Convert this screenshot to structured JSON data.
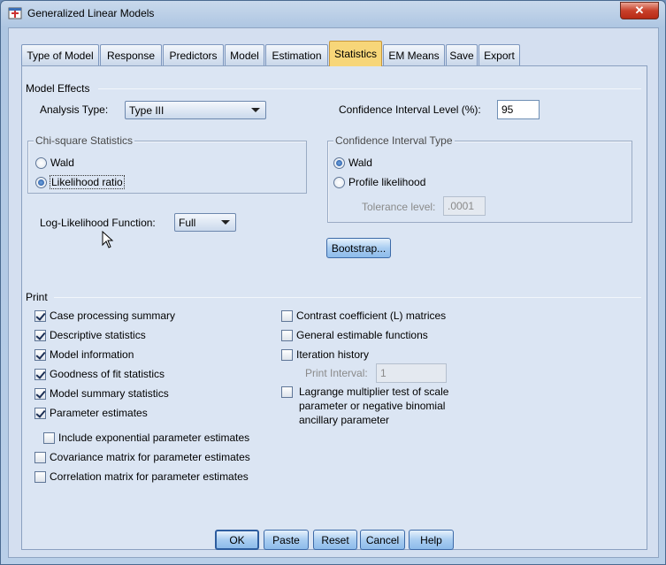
{
  "window": {
    "title": "Generalized Linear Models",
    "close_label": "✕"
  },
  "tabs": [
    {
      "label": "Type of Model",
      "active": false
    },
    {
      "label": "Response",
      "active": false
    },
    {
      "label": "Predictors",
      "active": false
    },
    {
      "label": "Model",
      "active": false
    },
    {
      "label": "Estimation",
      "active": false
    },
    {
      "label": "Statistics",
      "active": true
    },
    {
      "label": "EM Means",
      "active": false
    },
    {
      "label": "Save",
      "active": false
    },
    {
      "label": "Export",
      "active": false
    }
  ],
  "model_effects": {
    "section_label": "Model Effects",
    "analysis_type_label": "Analysis Type:",
    "analysis_type_value": "Type III",
    "ci_level_label": "Confidence Interval Level (%):",
    "ci_level_value": "95"
  },
  "chi_square": {
    "title": "Chi-square Statistics",
    "wald_label": "Wald",
    "likelihood_label": "Likelihood ratio",
    "selected": "likelihood"
  },
  "ci_type": {
    "title": "Confidence Interval Type",
    "wald_label": "Wald",
    "profile_label": "Profile likelihood",
    "selected": "wald",
    "tolerance_label": "Tolerance level:",
    "tolerance_value": ".0001"
  },
  "log_likelihood": {
    "label": "Log-Likelihood Function:",
    "value": "Full"
  },
  "bootstrap_label": "Bootstrap...",
  "print": {
    "section_label": "Print",
    "left": [
      {
        "label": "Case processing summary",
        "checked": true
      },
      {
        "label": "Descriptive statistics",
        "checked": true
      },
      {
        "label": "Model information",
        "checked": true
      },
      {
        "label": "Goodness of fit statistics",
        "checked": true
      },
      {
        "label": "Model summary statistics",
        "checked": true
      },
      {
        "label": "Parameter estimates",
        "checked": true
      }
    ],
    "include_exp": {
      "label": "Include exponential parameter estimates",
      "checked": false
    },
    "covariance": {
      "label": "Covariance matrix for parameter estimates",
      "checked": false
    },
    "correlation": {
      "label": "Correlation matrix for parameter estimates",
      "checked": false
    },
    "right": [
      {
        "label": "Contrast coefficient (L) matrices",
        "checked": false
      },
      {
        "label": "General estimable functions",
        "checked": false
      },
      {
        "label": "Iteration history",
        "checked": false
      }
    ],
    "print_interval_label": "Print Interval:",
    "print_interval_value": "1",
    "lagrange": {
      "line1": "Lagrange multiplier test of scale",
      "line2": "parameter or negative binomial",
      "line3": "ancillary parameter",
      "checked": false
    }
  },
  "buttons": {
    "ok": "OK",
    "paste": "Paste",
    "reset": "Reset",
    "cancel": "Cancel",
    "help": "Help"
  }
}
